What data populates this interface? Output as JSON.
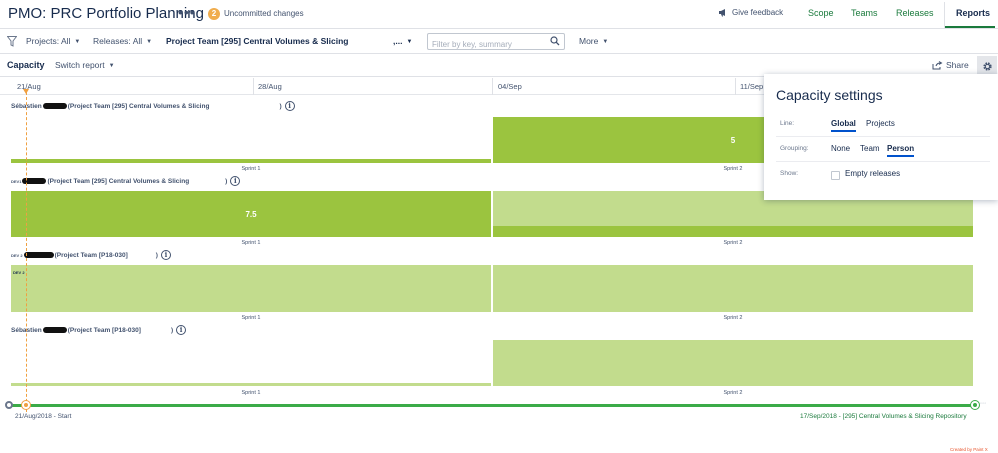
{
  "header": {
    "title": "PMO: PRC Portfolio Planning",
    "more_icon": "ellipsis-icon",
    "uncommitted_count": "2",
    "uncommitted_label": "Uncommitted changes",
    "feedback_label": "Give feedback",
    "tabs": [
      {
        "label": "Scope",
        "active": false
      },
      {
        "label": "Teams",
        "active": false
      },
      {
        "label": "Releases",
        "active": false
      },
      {
        "label": "Reports",
        "active": true
      }
    ]
  },
  "filters": {
    "projects": "Projects: All",
    "releases": "Releases: All",
    "team": "Project Team [295] Central Volumes & Slicing",
    "team_more": ",...",
    "search_placeholder": "Filter by key, summary",
    "more": "More"
  },
  "report": {
    "title": "Capacity",
    "switch_label": "Switch report",
    "share_label": "Share"
  },
  "timeline": {
    "dates": [
      "21/Aug",
      "28/Aug",
      "04/Sep",
      "11/Sep"
    ]
  },
  "lanes": [
    {
      "label_prefix": "Sébastien",
      "label_suffix": "(Project Team [295] Central Volumes & Slicing",
      "close": ")",
      "sprint1": "Sprint 1",
      "sprint2": "Sprint 2",
      "value": "5"
    },
    {
      "label_prefix": "DEV1",
      "label_suffix": "(Project Team [295] Central Volumes & Slicing",
      "close": ")",
      "sprint1": "Sprint 1",
      "sprint2": "Sprint 2",
      "value": "7.5"
    },
    {
      "label_prefix": "DEV 2",
      "label_suffix": "(Project Team [P18-030]",
      "close": ")",
      "sprint1": "Sprint 1",
      "sprint2": "Sprint 2",
      "tag": "DEV 2"
    },
    {
      "label_prefix": "Sébastien",
      "label_suffix": "(Project Team [P18-030]",
      "close": ")",
      "sprint1": "Sprint 1",
      "sprint2": "Sprint 2"
    }
  ],
  "scrubber": {
    "start_label": "21/Aug/2018 - Start",
    "end_label": "17/Sep/2018 - [295] Central Volumes & Slicing Repository"
  },
  "footer": {
    "created_by": "Created by Paint X"
  },
  "settings": {
    "title": "Capacity settings",
    "line_label": "Line:",
    "line_options": [
      "Global",
      "Projects"
    ],
    "line_selected": "Global",
    "grouping_label": "Grouping:",
    "grouping_options": [
      "None",
      "Team",
      "Person"
    ],
    "grouping_selected": "Person",
    "show_label": "Show:",
    "show_option": "Empty releases",
    "show_checked": false
  },
  "colors": {
    "accent_green": "#1a7a3c",
    "bar_dark": "#9bc43f",
    "bar_light": "#c2dc8d",
    "today_marker": "#f0a040",
    "badge": "#f0ad4e"
  }
}
